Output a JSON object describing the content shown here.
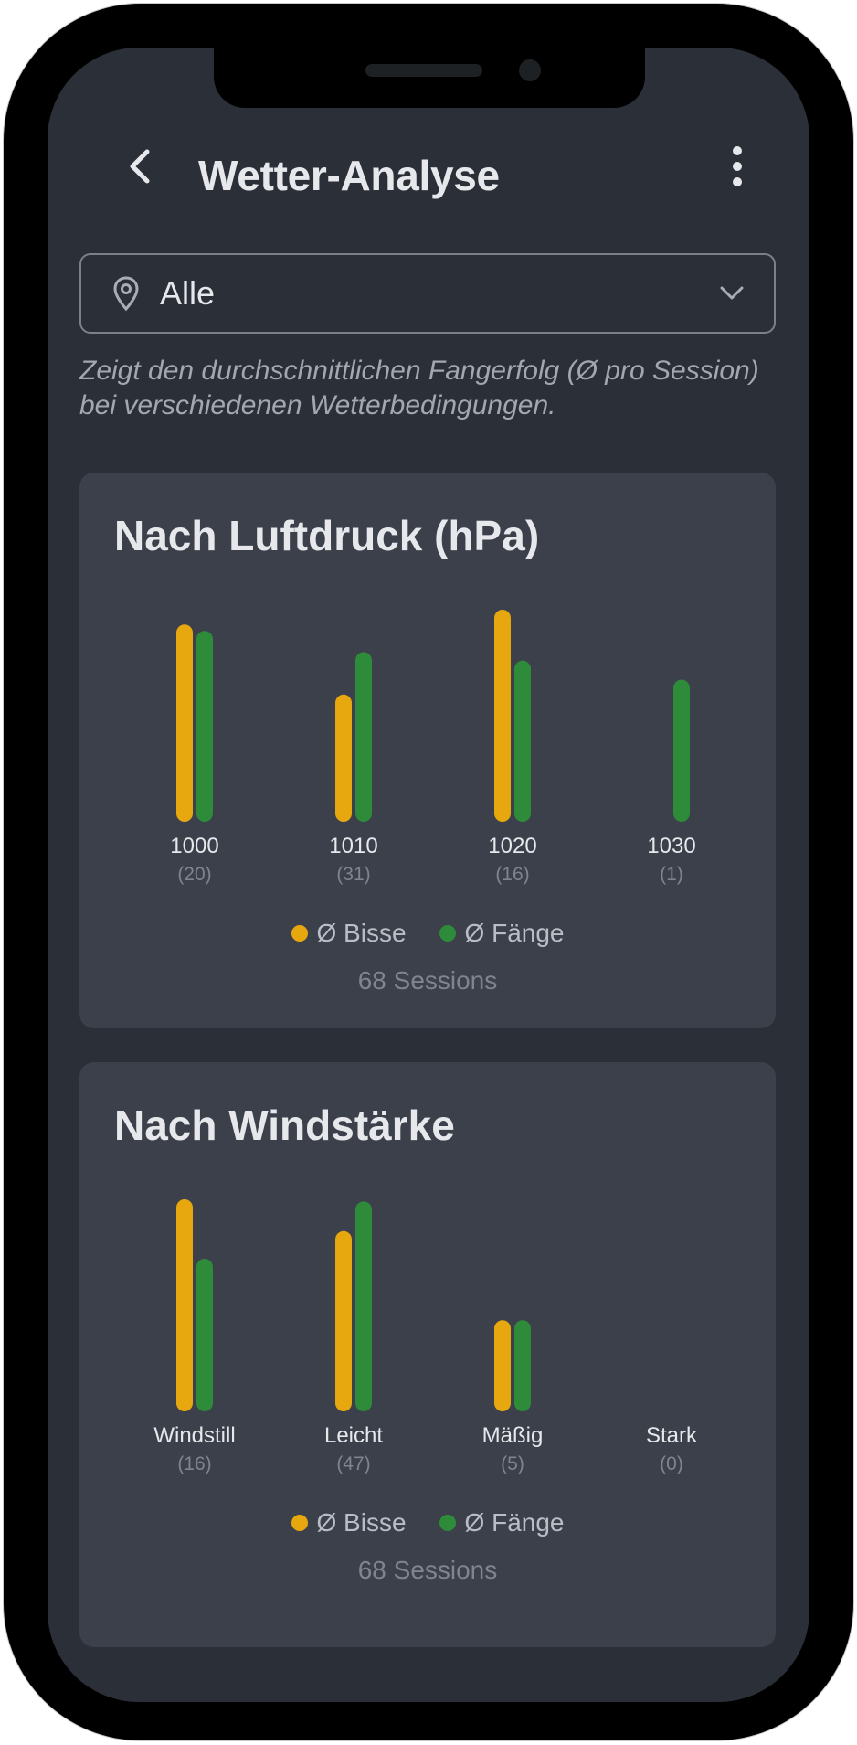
{
  "header": {
    "title": "Wetter-Analyse"
  },
  "location_select": {
    "value": "Alle"
  },
  "description": "Zeigt den durchschnittlichen Fangerfolg (Ø pro Session) bei verschiedenen Wetterbedingungen.",
  "colors": {
    "bites": "#e6a80e",
    "catches": "#2e8b3a",
    "card": "#3b404a",
    "screen": "#2b2f38"
  },
  "icons": {
    "back": "chevron-left-icon",
    "more": "more-vertical-icon",
    "location": "map-pin-icon",
    "dropdown": "chevron-down-icon"
  },
  "cards": [
    {
      "title": "Nach Luftdruck (hPa)",
      "legend_bites": "Ø Bisse",
      "legend_catches": "Ø Fänge",
      "sessions": "68 Sessions"
    },
    {
      "title": "Nach Windstärke",
      "legend_bites": "Ø Bisse",
      "legend_catches": "Ø Fänge",
      "sessions": "68 Sessions"
    }
  ],
  "chart_data": [
    {
      "type": "bar",
      "title": "Nach Luftdruck (hPa)",
      "categories": [
        "1000",
        "1010",
        "1020",
        "1030"
      ],
      "category_counts": [
        "(20)",
        "(31)",
        "(16)",
        "(1)"
      ],
      "series": [
        {
          "name": "Ø Bisse",
          "values": [
            0.93,
            0.6,
            1.0,
            0
          ]
        },
        {
          "name": "Ø Fänge",
          "values": [
            0.9,
            0.8,
            0.76,
            0.67
          ]
        }
      ],
      "ylim": [
        0,
        1
      ],
      "legend": "bottom",
      "grid": false
    },
    {
      "type": "bar",
      "title": "Nach Windstärke",
      "categories": [
        "Windstill",
        "Leicht",
        "Mäßig",
        "Stark"
      ],
      "category_counts": [
        "(16)",
        "(47)",
        "(5)",
        "(0)"
      ],
      "series": [
        {
          "name": "Ø Bisse",
          "values": [
            1.0,
            0.85,
            0.43,
            0
          ]
        },
        {
          "name": "Ø Fänge",
          "values": [
            0.72,
            0.99,
            0.43,
            0
          ]
        }
      ],
      "ylim": [
        0,
        1
      ],
      "legend": "bottom",
      "grid": false
    }
  ]
}
